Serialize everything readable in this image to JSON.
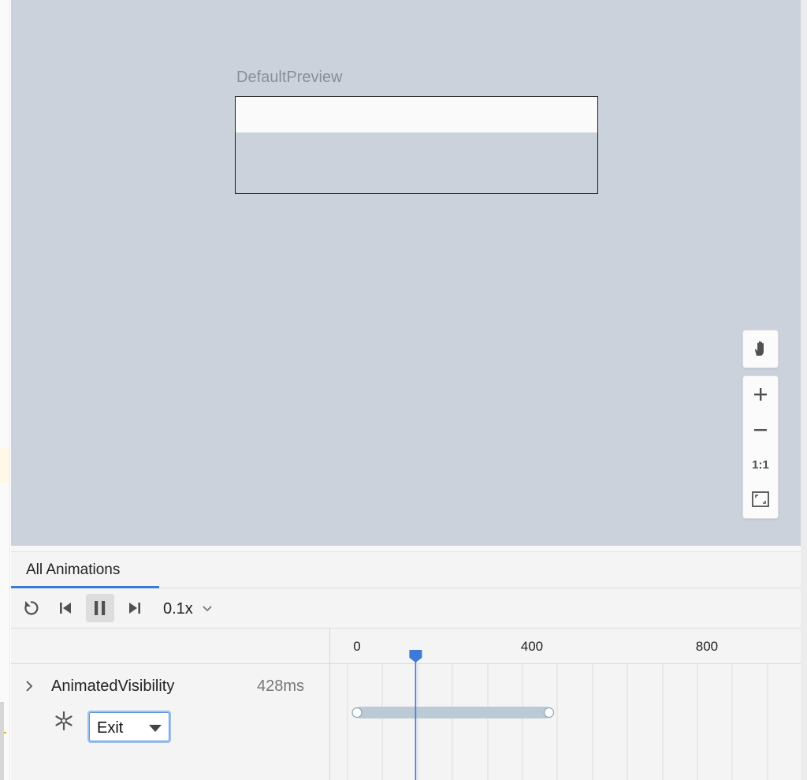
{
  "preview": {
    "title": "DefaultPreview"
  },
  "canvas_tools": {
    "pan_icon": "hand-icon",
    "zoom_in_icon": "plus-icon",
    "zoom_out_icon": "minus-icon",
    "actual_size_label": "1:1",
    "fit_icon": "fit-screen-icon"
  },
  "animation_panel": {
    "tabs": [
      {
        "label": "All Animations",
        "selected": true
      }
    ],
    "toolbar": {
      "replay_icon": "replay-icon",
      "jump_start_icon": "skip-to-start-icon",
      "pause_icon": "pause-icon",
      "jump_end_icon": "skip-to-end-icon",
      "speed": "0.1x"
    },
    "animations": [
      {
        "name": "AnimatedVisibility",
        "duration": "428ms",
        "state": "Exit",
        "state_icon": "freeze-icon"
      }
    ],
    "timeline": {
      "ticks": [
        "0",
        "400",
        "800"
      ],
      "tick_values": [
        0,
        400,
        800
      ],
      "bar_start_ms": 0,
      "bar_end_ms": 428,
      "playhead_ms": 80
    }
  },
  "colors": {
    "canvas_bg": "#cbd2db",
    "accent": "#3d7ad6",
    "timeline_bar": "#bccad6"
  }
}
